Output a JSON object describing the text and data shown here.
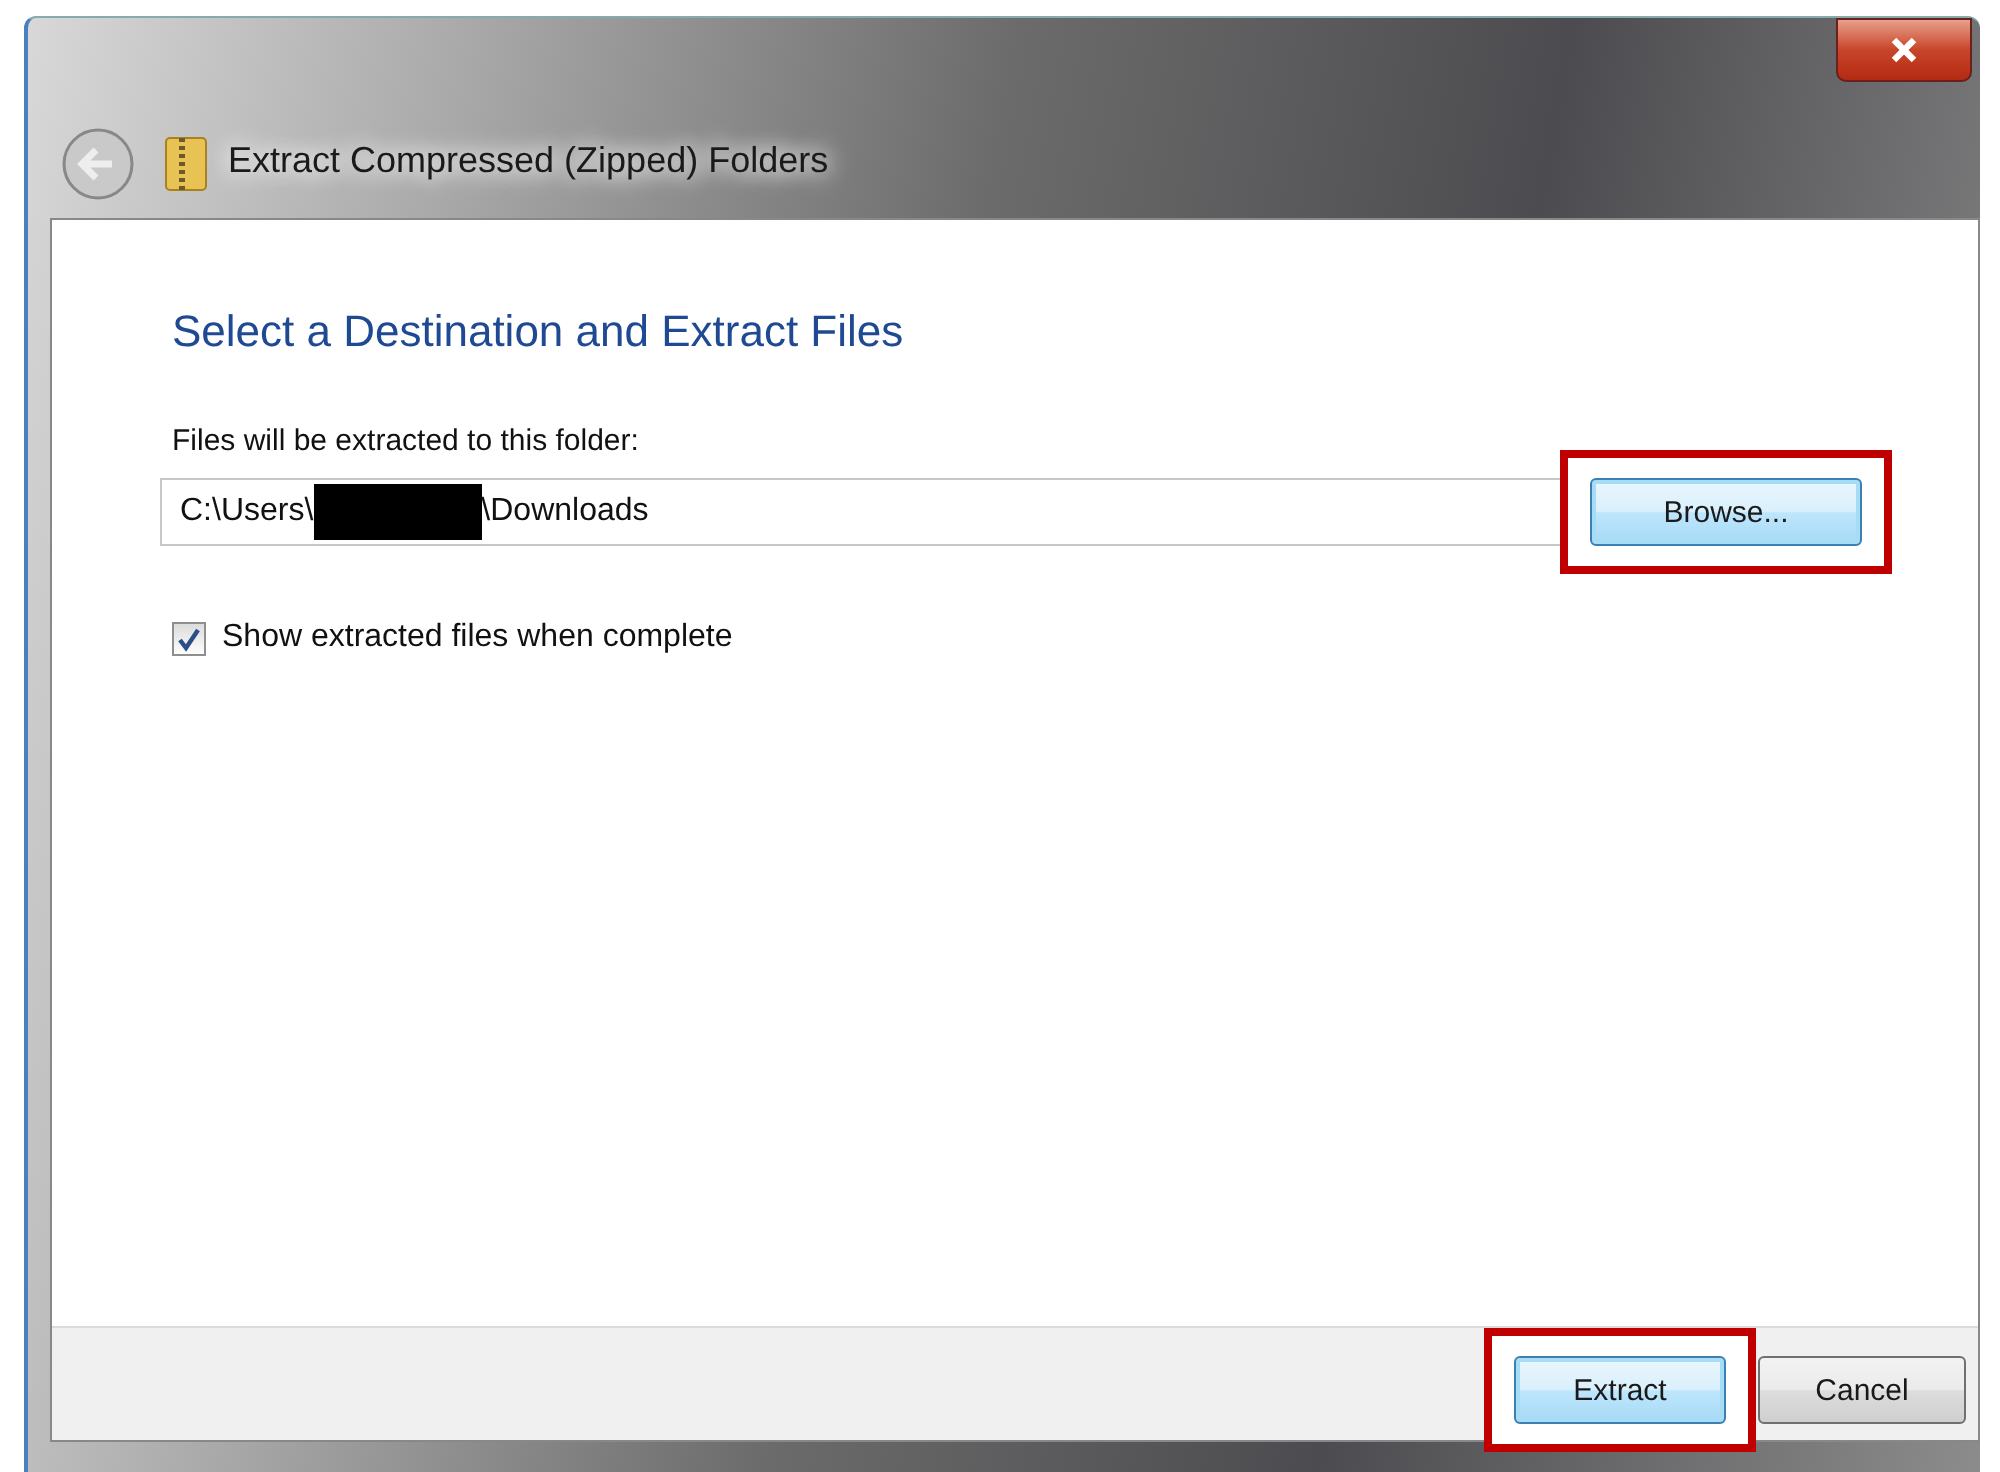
{
  "window": {
    "title": "Extract Compressed (Zipped) Folders"
  },
  "heading": "Select a Destination and Extract Files",
  "destination": {
    "label": "Files will be extracted to this folder:",
    "path": [
      {
        "kind": "text",
        "text": "C:\\Users\\"
      },
      {
        "kind": "redacted"
      },
      {
        "kind": "text",
        "text": "\\Downloads"
      }
    ],
    "browse": {
      "label": "Browse...",
      "focused": true,
      "highlighted": true
    }
  },
  "show_files": {
    "label": "Show extracted files when complete",
    "checked": true
  },
  "buttons": [
    {
      "label": "Extract",
      "focused": true,
      "highlighted": true
    },
    {
      "label": "Cancel",
      "focused": false,
      "highlighted": false
    }
  ]
}
